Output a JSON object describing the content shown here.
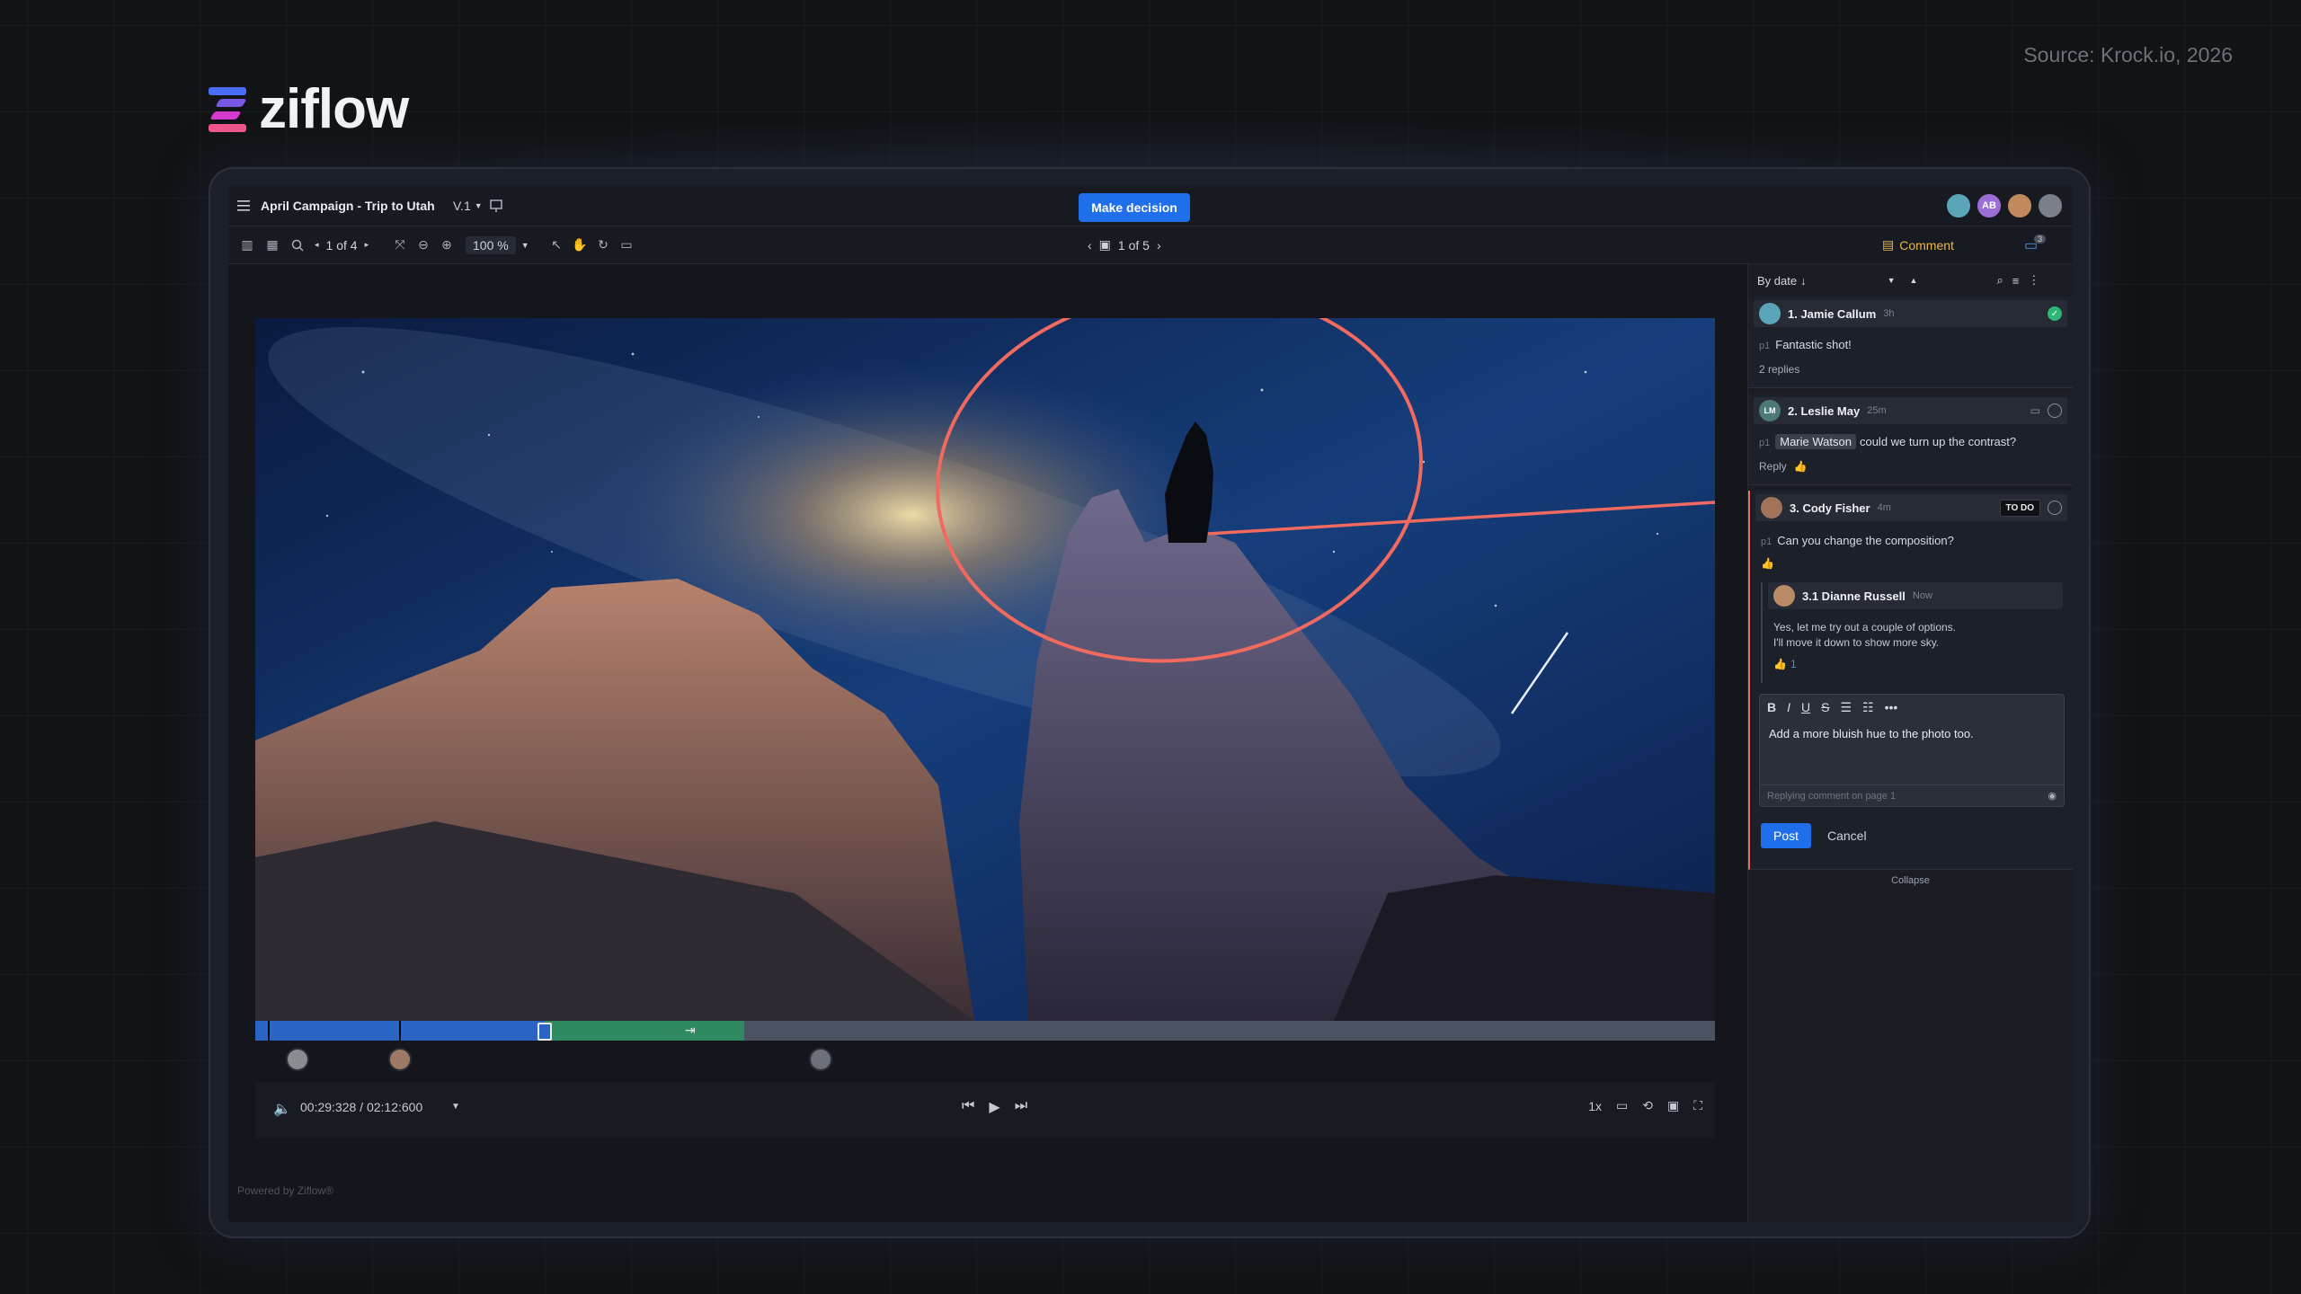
{
  "source_note": "Source: Krock.io, 2026",
  "brand": {
    "name": "ziflow",
    "colors": [
      "#4a6cf7",
      "#d63bd0",
      "#f2568c"
    ]
  },
  "titlebar": {
    "menu_icon": "hamburger-icon",
    "file_title": "April Campaign - Trip to Utah",
    "version": "V.1",
    "make_decision": "Make decision",
    "avatars": [
      {
        "initials": "",
        "color": "#5aa6b8"
      },
      {
        "initials": "AB",
        "color": "#9d6fd6"
      },
      {
        "initials": "",
        "color": "#c08a5c"
      },
      {
        "initials": "",
        "color": "#7a7f88"
      }
    ]
  },
  "toolbar": {
    "page_indicator": "1 of 4",
    "zoom": "100 %",
    "asset_indicator": "1 of 5",
    "comment_label": "Comment",
    "notification_count": "3"
  },
  "player": {
    "time": "00:29:328 / 02:12:600",
    "speed": "1x",
    "progress": {
      "played_fraction": 0.198,
      "annotation_fraction": 0.137
    }
  },
  "powered_by": "Powered by Ziflow®",
  "comments_panel": {
    "sort_label": "By date",
    "comments": [
      {
        "name": "1. Jamie Callum",
        "time": "3h",
        "page": "p1",
        "text": "Fantastic shot!",
        "replies": "2 replies",
        "resolved": true
      },
      {
        "name": "2. Leslie May",
        "time": "25m",
        "initials": "LM",
        "page": "p1",
        "mention": "Marie Watson",
        "text": "could we turn up the contrast?",
        "reply_label": "Reply"
      },
      {
        "name": "3. Cody Fisher",
        "time": "4m",
        "page": "p1",
        "text": "Can you change the composition?",
        "status": "TO DO",
        "reply": {
          "name": "3.1 Dianne Russell",
          "time": "Now",
          "line1": "Yes, let me try out a couple of options.",
          "line2": "I'll move it down to show more sky.",
          "likes": "1"
        }
      }
    ],
    "editor": {
      "text": "Add a more bluish hue to the photo too.",
      "context": "Replying comment on page 1",
      "post": "Post",
      "cancel": "Cancel"
    },
    "collapse": "Collapse"
  }
}
